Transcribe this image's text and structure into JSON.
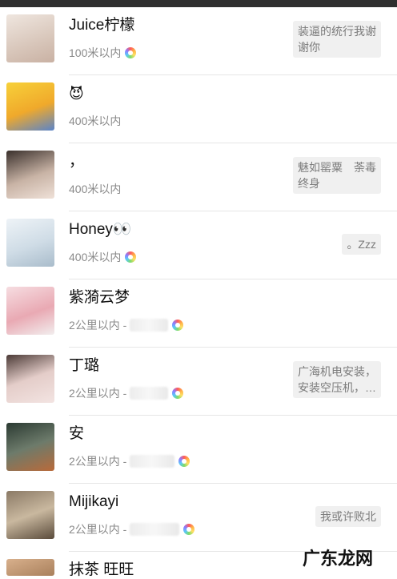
{
  "contacts": [
    {
      "name": "Juice柠檬",
      "distance": "100米以内",
      "status": "装逼的统行我谢\n谢你",
      "avatar_color": "#e8dcd4"
    },
    {
      "name": "😈",
      "distance": "400米以内",
      "status": "",
      "avatar_color": "#f5c518"
    },
    {
      "name": "，",
      "distance": "400米以内",
      "status": "魅如罂粟　荼毒\n终身",
      "avatar_color": "#c9c0b8"
    },
    {
      "name": "Honey👀",
      "distance": "400米以内",
      "status": "。Zzz",
      "avatar_color": "#dfe8ef"
    },
    {
      "name": "紫漪云梦",
      "distance": "2公里以内 -",
      "status": "",
      "avatar_color": "#f0c9cf"
    },
    {
      "name": "丁璐",
      "distance": "2公里以内 -",
      "status": "广海机电安装，\n安装空压机，…",
      "avatar_color": "#d9c7c7"
    },
    {
      "name": "安",
      "distance": "2公里以内 -",
      "status": "",
      "avatar_color": "#4a5a4f"
    },
    {
      "name": "Mijikayi",
      "distance": "2公里以内 -",
      "status": "我或许败北",
      "avatar_color": "#b7a58d"
    }
  ],
  "last_contact": {
    "name": "抹茶 旺旺",
    "avatar_color": "#caa27c"
  },
  "watermark": "广东龙网"
}
